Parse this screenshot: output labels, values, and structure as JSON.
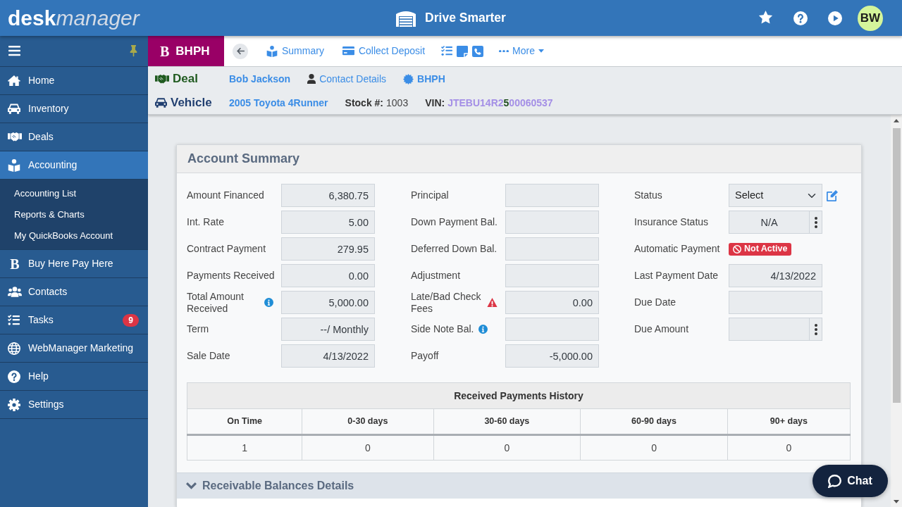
{
  "header": {
    "logo": {
      "primary": "desk",
      "secondary": "manager"
    },
    "dealership": "Drive Smarter",
    "avatar": "BW"
  },
  "sidebar": {
    "items": [
      {
        "label": "Home",
        "selected": false
      },
      {
        "label": "Inventory",
        "selected": false
      },
      {
        "label": "Deals",
        "selected": false
      },
      {
        "label": "Accounting",
        "selected": true,
        "children": [
          {
            "label": "Accounting List",
            "selected": false
          },
          {
            "label": "Reports & Charts",
            "selected": false
          },
          {
            "label": "My QuickBooks Account",
            "selected": false
          }
        ]
      },
      {
        "label": "Buy Here Pay Here",
        "selected": false,
        "glyph": "B"
      },
      {
        "label": "Contacts",
        "selected": false
      },
      {
        "label": "Tasks",
        "selected": false,
        "badge": "9"
      },
      {
        "label": "WebManager Marketing",
        "selected": false
      },
      {
        "label": "Help",
        "selected": false
      },
      {
        "label": "Settings",
        "selected": false
      }
    ]
  },
  "module_tab": {
    "glyph": "B",
    "label": "BHPH",
    "selected": true
  },
  "toolbar": {
    "links": [
      {
        "label": "Summary"
      },
      {
        "label": "Collect Deposit"
      }
    ],
    "more": {
      "label": "More"
    }
  },
  "record": {
    "deal": {
      "label": "Deal",
      "customer": "Bob Jackson",
      "contact": "Contact Details",
      "type": "BHPH"
    },
    "vehicle": {
      "label": "Vehicle",
      "name": "2005 Toyota 4Runner",
      "stock_label": "Stock #:",
      "stock": "1003",
      "vin_label": "VIN:",
      "vin": [
        {
          "text": "JTEBU14R2",
          "highlighted": false
        },
        {
          "text": "5",
          "highlighted": true
        },
        {
          "text": "00060537",
          "highlighted": false
        }
      ]
    }
  },
  "account_summary": {
    "title": "Account Summary",
    "columns": [
      {
        "fields": [
          {
            "kind": "input",
            "label": "Amount Financed",
            "value": "6,380.75"
          },
          {
            "kind": "input",
            "label": "Int. Rate",
            "value": "5.00"
          },
          {
            "kind": "input",
            "label": "Contract Payment",
            "value": "279.95"
          },
          {
            "kind": "input",
            "label": "Payments Received",
            "value": "0.00"
          },
          {
            "kind": "input",
            "label": "Total Amount Received",
            "value": "5,000.00",
            "info": true
          },
          {
            "kind": "input",
            "label": "Term",
            "value": "--/ Monthly"
          },
          {
            "kind": "input",
            "label": "Sale Date",
            "value": "4/13/2022"
          }
        ]
      },
      {
        "fields": [
          {
            "kind": "input",
            "label": "Principal"
          },
          {
            "kind": "input",
            "label": "Down Payment Bal."
          },
          {
            "kind": "input",
            "label": "Deferred Down Bal."
          },
          {
            "kind": "input",
            "label": "Adjustment"
          },
          {
            "kind": "input",
            "label": "Late/Bad Check Fees",
            "value": "0.00",
            "warning": true
          },
          {
            "kind": "input",
            "label": "Side Note Bal.",
            "info": true
          },
          {
            "kind": "input",
            "label": "Payoff",
            "value": "-5,000.00"
          }
        ]
      },
      {
        "fields": [
          {
            "kind": "select",
            "label": "Status",
            "value": "Select",
            "editable": true
          },
          {
            "kind": "input-menu",
            "label": "Insurance Status",
            "value": "N/A"
          },
          {
            "kind": "badge",
            "label": "Automatic Payment",
            "value": "Not Active",
            "active": false
          },
          {
            "kind": "input",
            "label": "Last Payment Date",
            "value": "4/13/2022"
          },
          {
            "kind": "input",
            "label": "Due Date"
          },
          {
            "kind": "input-menu",
            "label": "Due Amount"
          }
        ]
      }
    ],
    "payments_history": {
      "title": "Received Payments History",
      "columns": [
        "On Time",
        "0-30 days",
        "30-60 days",
        "60-90 days",
        "90+ days"
      ],
      "rows": [
        [
          "1",
          "0",
          "0",
          "0",
          "0"
        ]
      ]
    }
  },
  "receivable_section": {
    "title": "Receivable Balances Details",
    "expanded": true
  },
  "chat": {
    "label": "Chat"
  }
}
